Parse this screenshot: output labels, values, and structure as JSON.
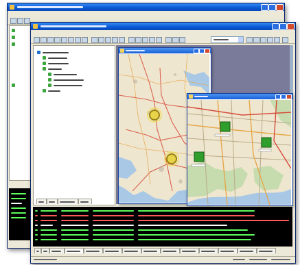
{
  "app": {
    "title": "",
    "menu_count": 9
  },
  "tree": {
    "root_label": "",
    "items": [
      "",
      "",
      "",
      "",
      "",
      "",
      "",
      ""
    ]
  },
  "map_windows": [
    {
      "title": ""
    },
    {
      "title": ""
    }
  ],
  "console_rows": [
    {
      "level": "warn"
    },
    {
      "level": "warn"
    },
    {
      "level": "info"
    },
    {
      "level": "info"
    },
    {
      "level": "warn"
    },
    {
      "level": "warn"
    },
    {
      "level": "warn"
    }
  ],
  "colors": {
    "titlebar": "#0a5ad6",
    "chrome": "#ece9d8",
    "console_bg": "#000000",
    "console_warn": "#ff5a5a",
    "console_info": "#5cff5c",
    "node_green": "#2f9e2a",
    "map_water": "#a8c8e6",
    "map_land": "#efe6cf"
  }
}
